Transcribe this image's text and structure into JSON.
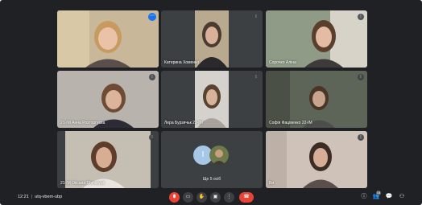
{
  "participants": [
    {
      "name": "",
      "bg": "#c9b79a",
      "skin": "#e9c2a8",
      "hair": "#c79a5f",
      "cloth": "#5a4f4a"
    },
    {
      "name": "Катерина Хоменко",
      "bg": "#b8a98f",
      "skin": "#d9b19b",
      "hair": "#4a3b31",
      "cloth": "#2a2a2c"
    },
    {
      "name": "Сорочко Аліна",
      "bg": "#8f9b86",
      "skin": "#e3bca3",
      "hair": "#5b3f2d",
      "cloth": "#3d3b39"
    },
    {
      "name": "21-ІМ Анна Розторгуєва",
      "bg": "#b9b3ad",
      "skin": "#dcb39b",
      "hair": "#6e4b35",
      "cloth": "#2d2b36"
    },
    {
      "name": "Лера Бурзячьк 22-ІМ",
      "bg": "#d5d2cd",
      "skin": "#d7b39b",
      "hair": "#5a4230",
      "cloth": "#a8a29b"
    },
    {
      "name": "Софія Фацівенко 22-ІМ",
      "bg": "#5d6458",
      "skin": "#c9a48c",
      "hair": "#4a3526",
      "cloth": "#4b4e4a"
    },
    {
      "name": "21-ІМ Оксана Shmaryuk",
      "bg": "#c5bfb3",
      "skin": "#d7ae93",
      "hair": "#5e3e2b",
      "cloth": "#e9e4dd"
    },
    {
      "name": "Ви",
      "bg": "#cfc2b8",
      "skin": "#d6ae97",
      "hair": "#3b2d26",
      "cloth": "#5a4f4a"
    }
  ],
  "others": {
    "label": "Ще 5 осіб",
    "avatar_letter": "І"
  },
  "bottom": {
    "time": "12:21",
    "code": "utq-vbem-ubp",
    "people_count": "18"
  },
  "icons": {
    "mic": "mic-off-icon",
    "cam": "camera-icon",
    "hand": "hand-icon",
    "present": "present-icon",
    "more": "more-icon",
    "end": "end-call-icon"
  }
}
